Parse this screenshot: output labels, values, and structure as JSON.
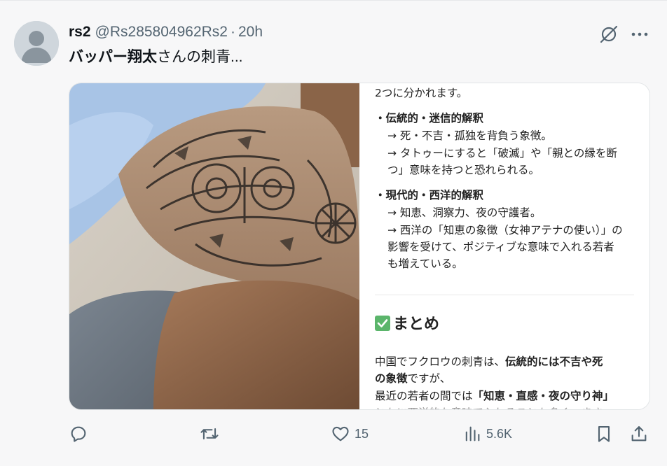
{
  "tweet": {
    "display_name": "rs2",
    "handle": "@Rs285804962Rs2",
    "separator": "·",
    "time": "20h",
    "text_bold": "バッパー翔太",
    "text_rest": "さんの刺青...",
    "icons": {
      "avatar": "default-avatar",
      "grok": "grok-icon",
      "more": "more-horizontal-icon"
    }
  },
  "media": {
    "photo_alt": "tattoo-photo",
    "doc": {
      "line1": "2つに分かれます。",
      "bullet1_title": "・伝統的・迷信的解釈",
      "bullet1_l1": "→ 死・不吉・孤独を背負う象徴。",
      "bullet1_l2": "→ タトゥーにすると「破滅」や「親との縁を断",
      "bullet1_l3": "つ」意味を持つと恐れられる。",
      "bullet2_title": "・現代的・西洋的解釈",
      "bullet2_l1": "→ 知恵、洞察力、夜の守護者。",
      "bullet2_l2": "→ 西洋の「知恵の象徴（女神アテナの使い）」の",
      "bullet2_l3": "影響を受けて、ポジティブな意味で入れる若者",
      "bullet2_l4": "も増えている。",
      "summary": "まとめ",
      "para1_a": "中国でフクロウの刺青は、",
      "para1_b": "伝統的には不吉や死",
      "para2_a": "の象徴",
      "para2_b": "ですが、",
      "para3_a": "最近の若者の間では",
      "para3_b": "「知恵・直感・夜の守り神」",
      "para4": "ともに西洋的な意味で入れることも多く、まさ"
    }
  },
  "actions": {
    "reply": {
      "icon": "reply-icon",
      "count": ""
    },
    "repost": {
      "icon": "repost-icon",
      "count": ""
    },
    "like": {
      "icon": "heart-icon",
      "count": "15"
    },
    "views": {
      "icon": "views-chart-icon",
      "count": "5.6K"
    },
    "bookmark": {
      "icon": "bookmark-icon",
      "count": ""
    },
    "share": {
      "icon": "share-icon",
      "count": ""
    }
  },
  "colors": {
    "background": "#f7f7f8",
    "secondary_text": "#536471",
    "primary_text": "#0f1419",
    "check_green": "#5bb56b"
  }
}
